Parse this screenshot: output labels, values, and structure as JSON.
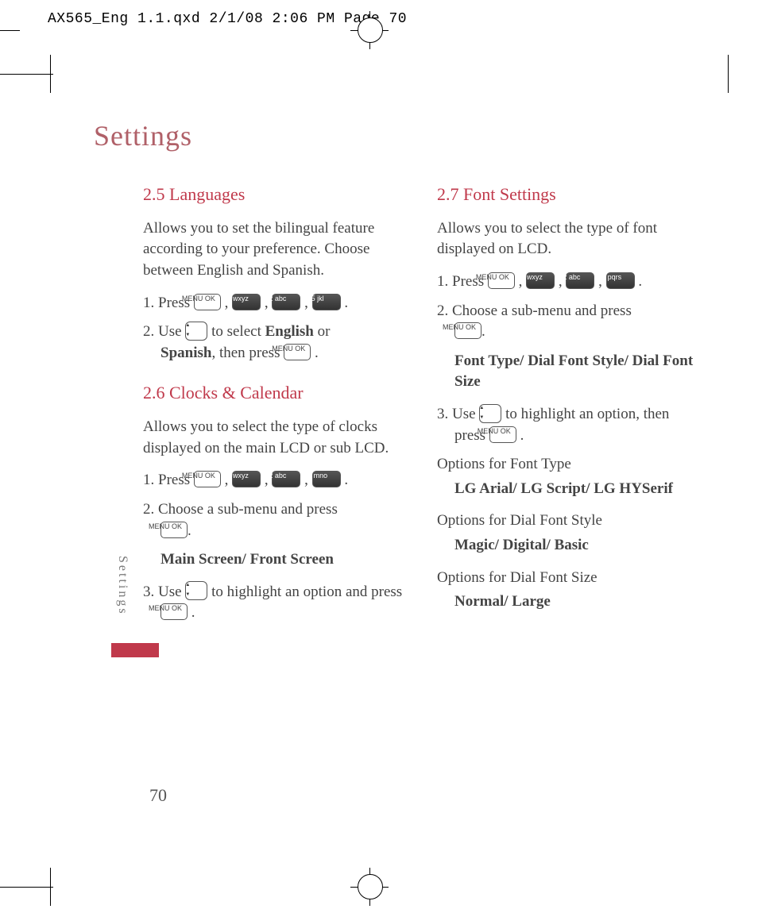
{
  "slug": "AX565_Eng 1.1.qxd  2/1/08  2:06 PM  Page 70",
  "page_title": "Settings",
  "side_tab": "Settings",
  "page_number": "70",
  "keys": {
    "ok": "MENU\nOK",
    "k9": "9 wxyz",
    "k2": "2 abc",
    "k5": "5  jkl",
    "k6": "6 mno",
    "k7": "7 pqrs"
  },
  "left": {
    "sec25": {
      "heading": "2.5 Languages",
      "intro": "Allows you to set the bilingual feature according to your preference. Choose between English and Spanish.",
      "step1_a": "1. Press ",
      "step2_a": "2. Use ",
      "step2_b": " to select ",
      "step2_eng": "English",
      "step2_or": " or ",
      "step2_spa": "Spanish",
      "step2_c": ", then press ",
      "period": " ."
    },
    "sec26": {
      "heading": "2.6 Clocks & Calendar",
      "intro": "Allows you to select the type of clocks displayed on the main LCD or sub LCD.",
      "step1_a": "1. Press ",
      "step2_a": "2. Choose a sub-menu and press ",
      "step2_period": ".",
      "sub": "Main Screen/ Front Screen",
      "step3_a": "3. Use ",
      "step3_b": " to highlight an option and press ",
      "step3_period": " ."
    },
    "comma": " , "
  },
  "right": {
    "sec27": {
      "heading": "2.7 Font Settings",
      "intro": "Allows you to select the type of font displayed on LCD.",
      "step1_a": "1. Press ",
      "step2_a": "2. Choose a sub-menu and press ",
      "step2_period": ".",
      "sub1": "Font Type/ Dial Font Style/ Dial Font Size",
      "step3_a": "3. Use ",
      "step3_b": " to highlight an option, then press ",
      "step3_period": " .",
      "opt_ft_label": "Options for Font Type",
      "opt_ft": "LG Arial/ LG Script/ LG HYSerif",
      "opt_dfs_label": "Options for Dial Font Style",
      "opt_dfs": "Magic/ Digital/ Basic",
      "opt_dfsize_label": "Options for Dial Font Size",
      "opt_dfsize": "Normal/ Large"
    },
    "comma": " , ",
    "period": " ."
  }
}
